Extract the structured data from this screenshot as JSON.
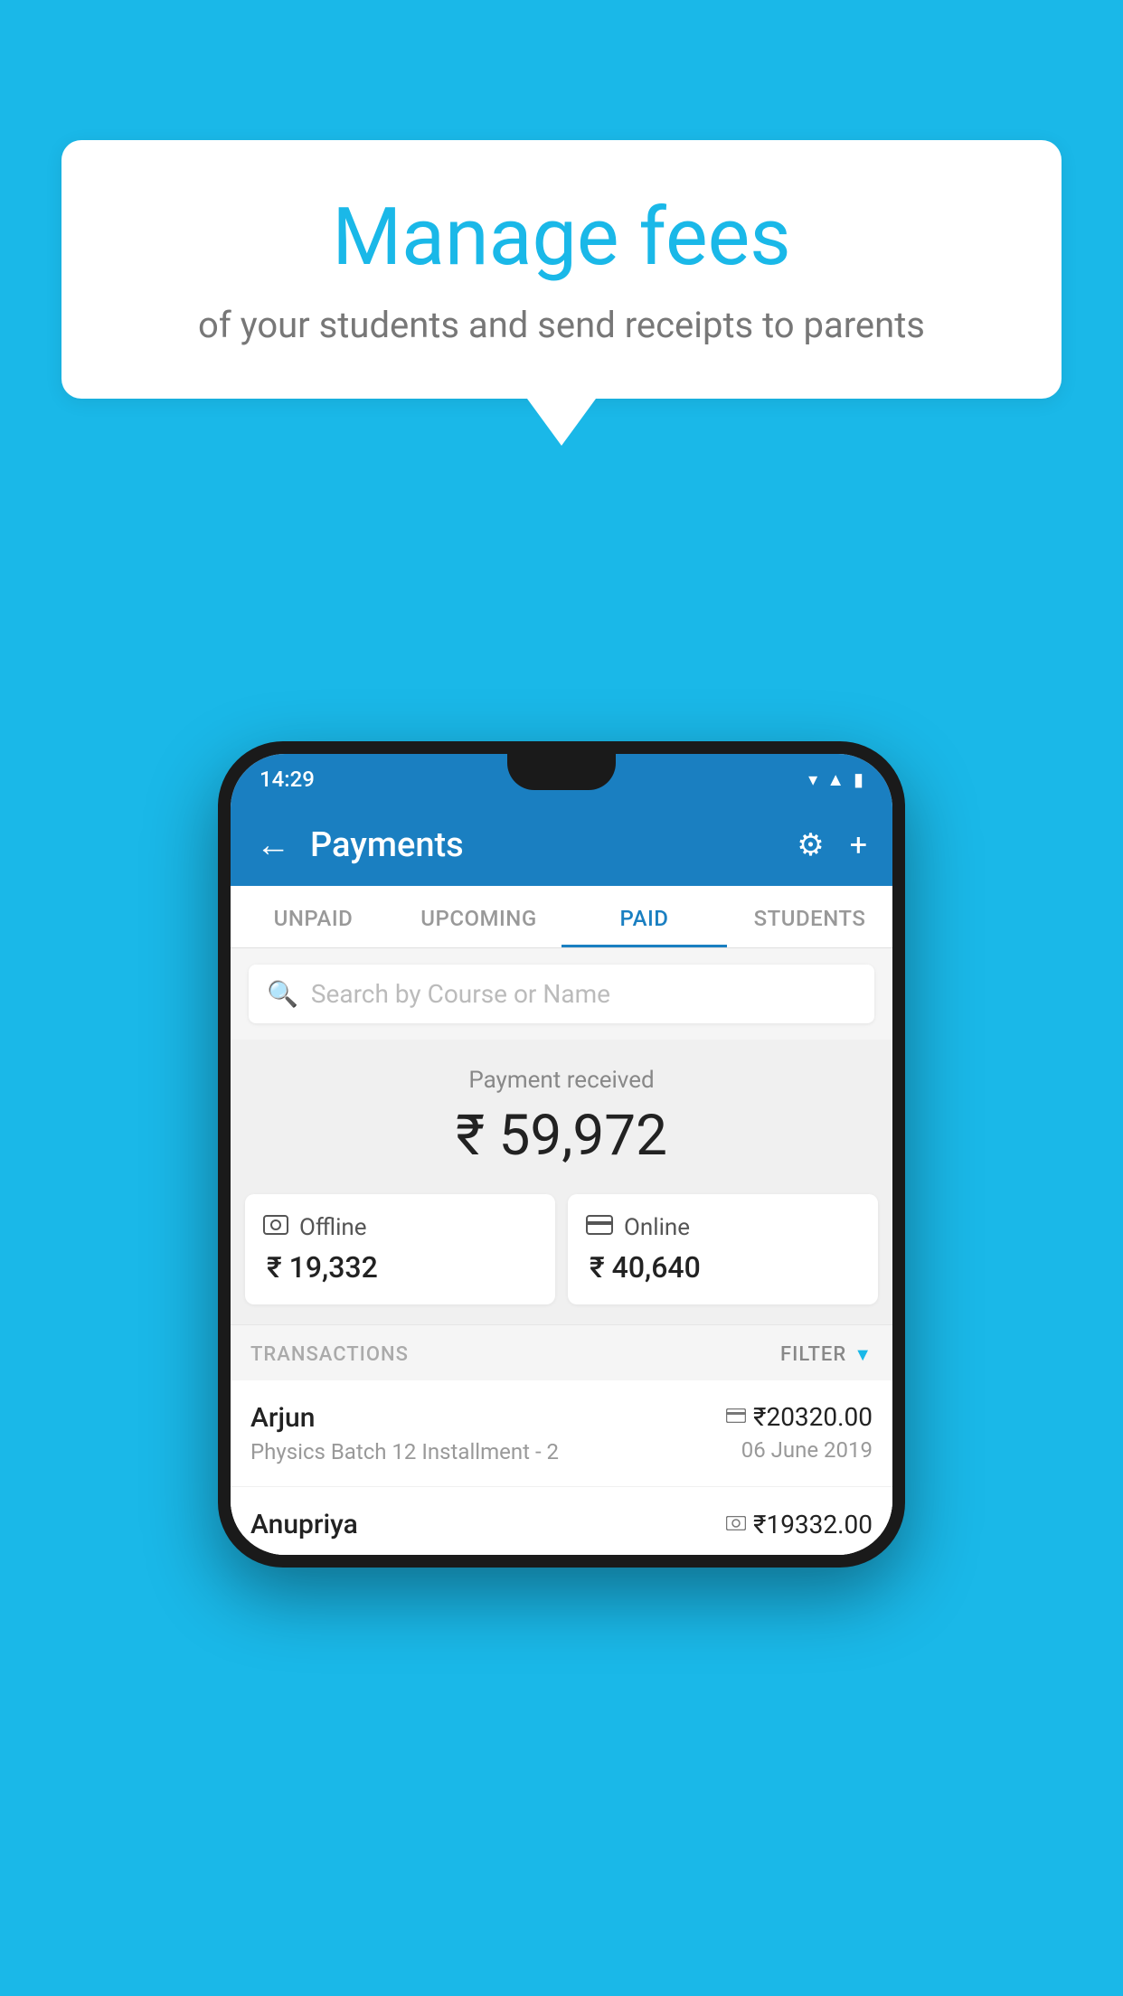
{
  "page": {
    "background_color": "#1ab8e8"
  },
  "speech_bubble": {
    "title": "Manage fees",
    "subtitle": "of your students and send receipts to parents"
  },
  "phone": {
    "status_bar": {
      "time": "14:29",
      "icons": "▾ ◂ ▮"
    },
    "header": {
      "back_label": "←",
      "title": "Payments",
      "settings_icon": "⚙",
      "add_icon": "+"
    },
    "tabs": [
      {
        "label": "UNPAID",
        "active": false
      },
      {
        "label": "UPCOMING",
        "active": false
      },
      {
        "label": "PAID",
        "active": true
      },
      {
        "label": "STUDENTS",
        "active": false
      }
    ],
    "search": {
      "placeholder": "Search by Course or Name"
    },
    "payment_summary": {
      "label": "Payment received",
      "amount": "₹ 59,972"
    },
    "payment_cards": [
      {
        "icon": "offline",
        "label": "Offline",
        "amount": "₹ 19,332"
      },
      {
        "icon": "online",
        "label": "Online",
        "amount": "₹ 40,640"
      }
    ],
    "transactions": {
      "header_label": "TRANSACTIONS",
      "filter_label": "FILTER",
      "rows": [
        {
          "name": "Arjun",
          "detail": "Physics Batch 12 Installment - 2",
          "amount": "₹20320.00",
          "date": "06 June 2019",
          "payment_type": "card"
        },
        {
          "name": "Anupriya",
          "detail": "",
          "amount": "₹19332.00",
          "date": "",
          "payment_type": "offline"
        }
      ]
    }
  }
}
